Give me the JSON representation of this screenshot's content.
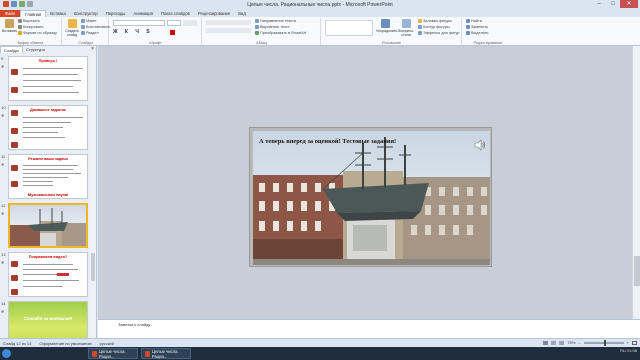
{
  "window": {
    "title": "Целые числа. Рациональные числа.pptx - Microsoft PowerPoint",
    "controls": [
      "–",
      "□",
      "✕"
    ]
  },
  "ribbon_tabs": [
    "Файл",
    "Главная",
    "Вставка",
    "Конструктор",
    "Переходы",
    "Анимация",
    "Показ слайдов",
    "Рецензирование",
    "Вид"
  ],
  "ribbon": {
    "clipboard": {
      "paste": "Вставить",
      "cut": "Вырезать",
      "copy": "Копировать",
      "format": "Формат по образцу",
      "label": "Буфер обмена"
    },
    "slides": {
      "create": "Создать слайд",
      "layout": "Макет",
      "reset": "Восстановить",
      "section": "Раздел",
      "label": "Слайды"
    },
    "font": {
      "label": "Шрифт"
    },
    "paragraph": {
      "dir": "Направление текста",
      "align": "Выровнять текст",
      "smartart": "Преобразовать в SmartArt",
      "label": "Абзац"
    },
    "drawing": {
      "arrange": "Упорядочить",
      "styles": "Экспресс-стили",
      "fill": "Заливка фигуры",
      "outline": "Контур фигуры",
      "effects": "Эффекты для фигур",
      "label": "Рисование"
    },
    "editing": {
      "find": "Найти",
      "replace": "Заменить",
      "select": "Выделить",
      "label": "Редактирование"
    }
  },
  "pane_tabs": [
    "Слайды",
    "Структура"
  ],
  "thumbs": [
    {
      "num": "9",
      "title": "Проверь !"
    },
    {
      "num": "10",
      "title": "Домашнее задание"
    },
    {
      "num": "11",
      "title": "Решаем ваши задачи",
      "footer": "Музыкальная пауза!"
    },
    {
      "num": "12",
      "title": ""
    },
    {
      "num": "13",
      "title": "Поправляем видео?"
    },
    {
      "num": "14",
      "title": "Спасибо за внимание!"
    }
  ],
  "slide": {
    "title": "А теперь вперед за оценкой! Тестовые задания!"
  },
  "notes": {
    "text": "Заметки к слайду"
  },
  "status": {
    "slide": "Слайд 12 из 14",
    "theme": "Оформление по умолчанию",
    "lang": "русский",
    "zoom": "75%"
  },
  "taskbar": {
    "apps": [
      "Целые числа. Рацио...",
      "Целые числа. Рацио..."
    ],
    "time": "21:08",
    "lang": "RU"
  },
  "colors": {
    "file_tab": "#d24726",
    "current_thumb_border": "#f0b429",
    "taskbar": "#1f2d3d"
  }
}
